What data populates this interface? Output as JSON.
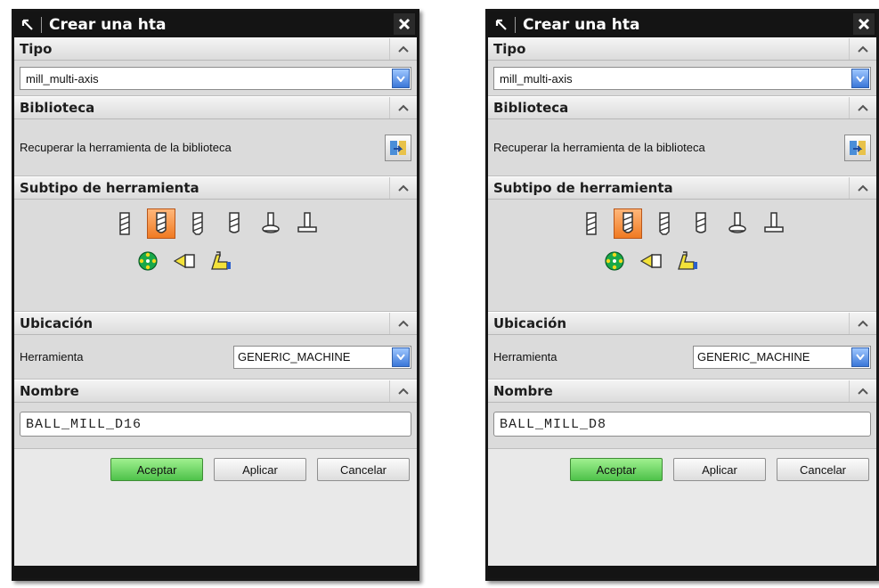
{
  "dialogs": [
    {
      "title": "Crear una hta",
      "sections": {
        "tipo": {
          "header": "Tipo",
          "value": "mill_multi-axis"
        },
        "biblioteca": {
          "header": "Biblioteca",
          "label": "Recuperar la herramienta de la biblioteca"
        },
        "subtipo": {
          "header": "Subtipo de herramienta",
          "selected_index": 1
        },
        "ubicacion": {
          "header": "Ubicación",
          "label": "Herramienta",
          "value": "GENERIC_MACHINE"
        },
        "nombre": {
          "header": "Nombre",
          "value": "BALL_MILL_D16"
        }
      },
      "buttons": {
        "ok": "Aceptar",
        "apply": "Aplicar",
        "cancel": "Cancelar"
      }
    },
    {
      "title": "Crear una hta",
      "sections": {
        "tipo": {
          "header": "Tipo",
          "value": "mill_multi-axis"
        },
        "biblioteca": {
          "header": "Biblioteca",
          "label": "Recuperar la herramienta de la biblioteca"
        },
        "subtipo": {
          "header": "Subtipo de herramienta",
          "selected_index": 1
        },
        "ubicacion": {
          "header": "Ubicación",
          "label": "Herramienta",
          "value": "GENERIC_MACHINE"
        },
        "nombre": {
          "header": "Nombre",
          "value": "BALL_MILL_D8"
        }
      },
      "buttons": {
        "ok": "Aceptar",
        "apply": "Aplicar",
        "cancel": "Cancelar"
      }
    }
  ],
  "icons": {
    "title": "pointer-arrow-icon",
    "close": "close-x-icon",
    "collapse": "chevron-up-icon",
    "dropdown": "chevron-down-icon",
    "library": "library-retrieve-icon",
    "tool_subtypes": [
      "mill-tool-icon",
      "ball-mill-tool-icon",
      "chamfer-mill-tool-icon",
      "spherical-mill-tool-icon",
      "t-cutter-tool-icon",
      "barrel-tool-icon",
      "thread-mill-tool-icon",
      "drill-tool-icon",
      "user-defined-tool-icon"
    ]
  },
  "colors": {
    "title_bar": "#141414",
    "selected_subtype": "#f07a22",
    "ok_button": "#4ec24a",
    "combo_button": "#3b77d8"
  }
}
